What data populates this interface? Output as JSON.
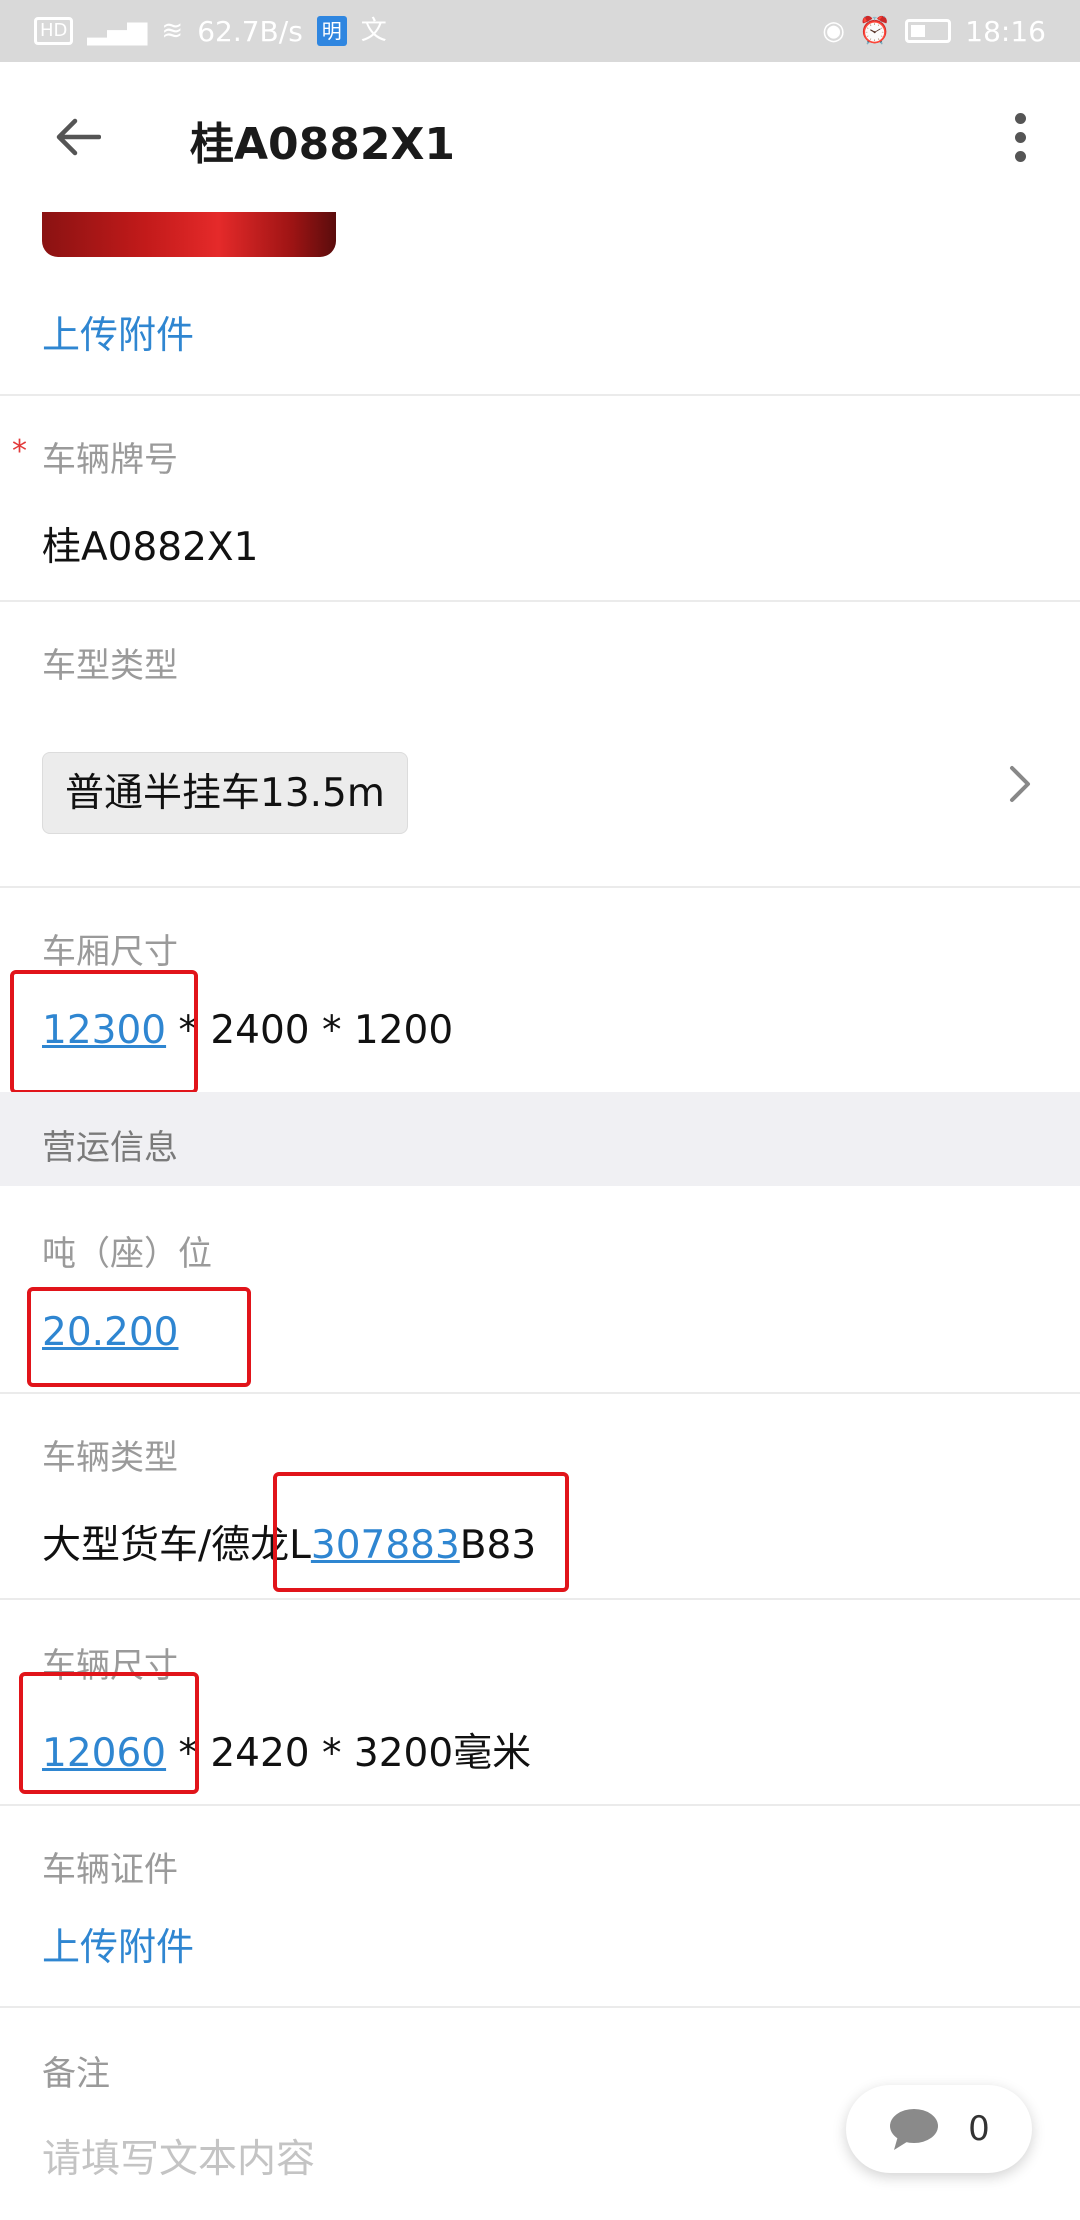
{
  "status_bar": {
    "network_speed": "62.7B/s",
    "time": "18:16",
    "icons": [
      "hd-icon",
      "signal-icon",
      "wifi-icon",
      "app-icon",
      "translate-icon",
      "eye-icon",
      "alarm-icon",
      "battery-icon"
    ]
  },
  "app_bar": {
    "title": "桂A0882X1"
  },
  "attachments_top": {
    "upload_label": "上传附件"
  },
  "plate": {
    "label": "车辆牌号",
    "required_mark": "*",
    "value": "桂A0882X1"
  },
  "vehicle_model_type": {
    "label": "车型类型",
    "tag": "普通半挂车13.5m"
  },
  "cargo_box_size": {
    "label": "车厢尺寸",
    "value_highlight": "12300",
    "value_rest": " * 2400 * 1200"
  },
  "operation_group": {
    "title": "营运信息"
  },
  "tonnage": {
    "label": "吨（座）位",
    "value": "20.200"
  },
  "vehicle_type": {
    "label": "车辆类型",
    "value_prefix": "大型货车/德龙L",
    "value_highlight": "307883",
    "value_suffix": "B83"
  },
  "vehicle_size": {
    "label": "车辆尺寸",
    "value_highlight": "12060",
    "value_rest": " * 2420 * 3200毫米"
  },
  "vehicle_certificate": {
    "label": "车辆证件",
    "upload_label": "上传附件"
  },
  "remarks": {
    "label": "备注",
    "placeholder": "请填写文本内容"
  },
  "comment_fab": {
    "count": "0"
  },
  "colors": {
    "link": "#2f86d1",
    "highlight_box": "#e1141a",
    "required": "#e23a3a"
  }
}
